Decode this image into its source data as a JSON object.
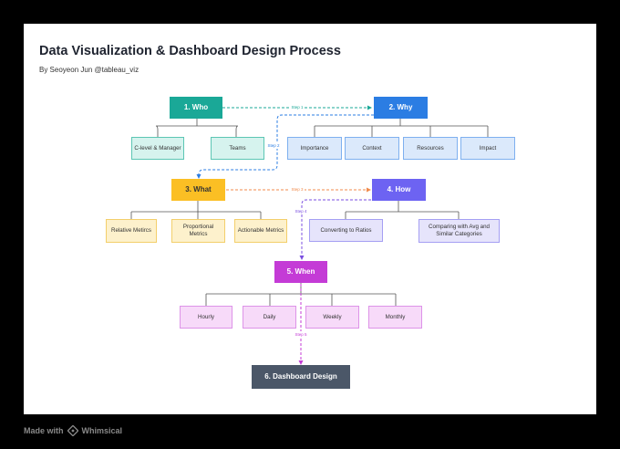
{
  "title": "Data Visualization & Dashboard Design Process",
  "subtitle": "By Seoyeon Jun @tableau_viz",
  "nodes": {
    "who": "1. Who",
    "why": "2. Why",
    "what": "3. What",
    "how": "4. How",
    "when": "5. When",
    "dashboard": "6. Dashboard Design"
  },
  "who_children": [
    "C-level & Manager",
    "Teams"
  ],
  "why_children": [
    "Importance",
    "Context",
    "Resources",
    "Impact"
  ],
  "what_children": [
    "Relative Metircs",
    "Proportional Metrics",
    "Actionable Metrics"
  ],
  "how_children": [
    "Converting to Ratios",
    "Comparing with Avg and Similar Categories"
  ],
  "when_children": [
    "Hourly",
    "Daily",
    "Weekly",
    "Monthly"
  ],
  "steps": [
    "Step 1",
    "Step 2",
    "Step 3",
    "Step 4",
    "Step 5"
  ],
  "footer": {
    "made_with": "Made with",
    "brand": "Whimsical"
  },
  "colors": {
    "who": "#1aa897",
    "why": "#2b7de3",
    "what": "#fbbf24",
    "how": "#6d63f2",
    "when": "#c43bd6",
    "dashboard": "#4b5768"
  }
}
